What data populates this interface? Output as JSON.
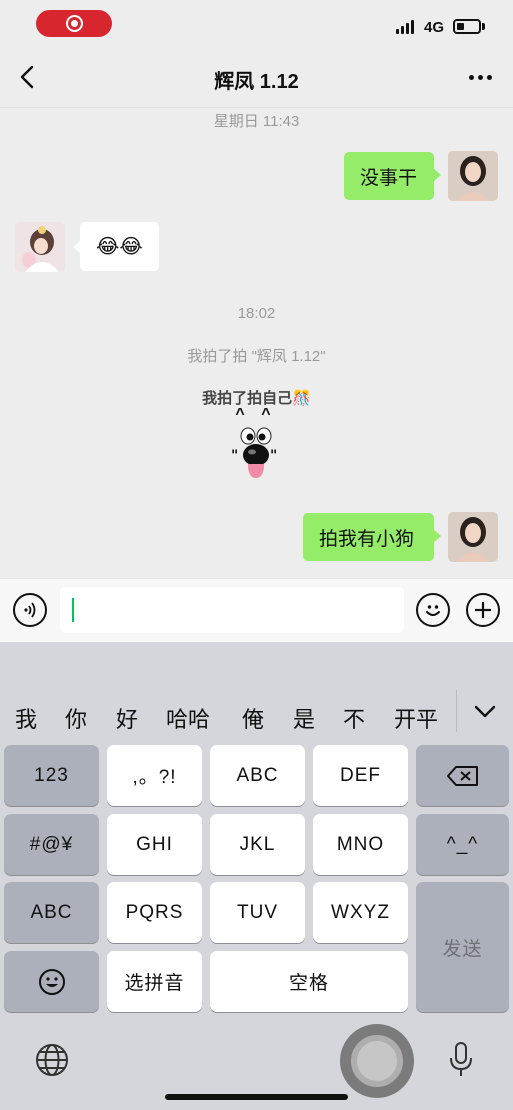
{
  "status_bar": {
    "network": "4G",
    "battery_level": 0.35,
    "icons": [
      "screen-record-icon",
      "signal-icon",
      "battery-icon"
    ]
  },
  "nav": {
    "title": "辉凤 1.12",
    "icons": [
      "back-chevron-icon",
      "more-dots-icon"
    ]
  },
  "chat": {
    "timestamp_1": "星期日 11:43",
    "msg_1": "没事干",
    "msg_2": "😂😂",
    "timestamp_2": "18:02",
    "pat_other": "我拍了拍 \"辉凤 1.12\"",
    "pat_self": "我拍了拍自己🎊",
    "dog_eyebrows": "^ ^",
    "msg_3": "拍我有小狗"
  },
  "input_bar": {
    "value": "",
    "icons": [
      "voice-icon",
      "emoji-icon",
      "plus-icon"
    ]
  },
  "keyboard": {
    "candidates": [
      "我",
      "你",
      "好",
      "哈哈",
      "俺",
      "是",
      "不",
      "开平"
    ],
    "keys": {
      "num": "123",
      "punct": ",。?!",
      "abc": "ABC",
      "def": "DEF",
      "sym": "#@¥",
      "ghi": "GHI",
      "jkl": "JKL",
      "mno": "MNO",
      "face": "^_^",
      "abc_switch": "ABC",
      "pqrs": "PQRS",
      "tuv": "TUV",
      "wxyz": "WXYZ",
      "send": "发送",
      "pinyin": "选拼音",
      "space": "空格"
    },
    "icons": [
      "delete-icon",
      "emoji-key-icon",
      "globe-icon",
      "mic-icon",
      "collapse-chevron-icon"
    ]
  },
  "colors": {
    "my_bubble": "#95ec69",
    "caret": "#07c160",
    "record": "#d8262f"
  }
}
